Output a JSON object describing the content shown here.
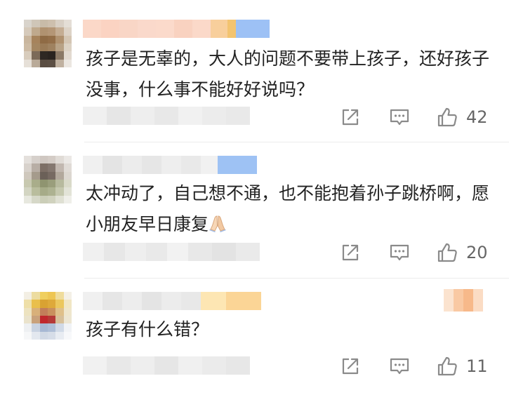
{
  "comments": [
    {
      "text": "孩子是无辜的，大人的问题不要带上孩子，还好孩子没事，什么事不能好好说吗？",
      "likes": "42"
    },
    {
      "text": "太冲动了，自己想不通，也不能抱着孙子跳桥啊，愿小朋友早日康复",
      "emoji": "folded-hands",
      "likes": "20"
    },
    {
      "text": "孩子有什么错？",
      "likes": "11"
    }
  ],
  "icons": {
    "share": "share-icon",
    "reply": "reply-icon",
    "like": "thumbs-up-icon"
  },
  "colors": {
    "text": "#222222",
    "icon": "#8a8a8a",
    "count": "#666666"
  }
}
